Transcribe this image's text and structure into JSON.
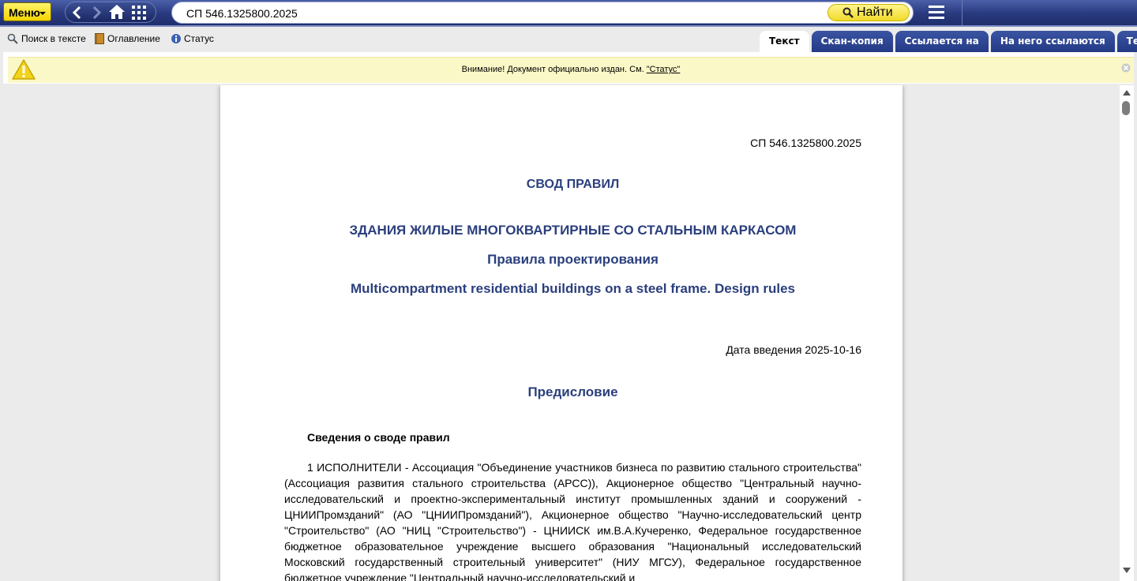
{
  "toolbar": {
    "menu_label": "Меню",
    "search_value": "СП 546.1325800.2025",
    "find_label": "Найти"
  },
  "tools": {
    "search_in_text": "Поиск в тексте",
    "contents": "Оглавление",
    "status": "Статус"
  },
  "tabs": [
    {
      "label": "Текст",
      "active": true
    },
    {
      "label": "Скан-копия",
      "active": false
    },
    {
      "label": "Ссылается на",
      "active": false
    },
    {
      "label": "На него ссылаются",
      "active": false
    },
    {
      "label": "Термины",
      "active": false
    }
  ],
  "warning": {
    "text": "Внимание! Документ официально издан. См. ",
    "link": "\"Статус\""
  },
  "document": {
    "code": "СП 546.1325800.2025",
    "type_title": "СВОД ПРАВИЛ",
    "title": "ЗДАНИЯ ЖИЛЫЕ МНОГОКВАРТИРНЫЕ СО СТАЛЬНЫМ КАРКАСОМ",
    "subtitle": "Правила проектирования",
    "title_en": "Multicompartment residential buildings on a steel frame. Design rules",
    "intro_date": "Дата введения 2025-10-16",
    "foreword_title": "Предисловие",
    "info_title": "Сведения о своде правил",
    "para1": "1 ИСПОЛНИТЕЛИ - Ассоциация \"Объединение участников бизнеса по развитию стального строительства\" (Ассоциация развития стального строительства (АРСС)), Акционерное общество \"Центральный научно-исследовательский и проектно-экспериментальный институт промышленных зданий и сооружений - ЦНИИПромзданий\" (АО \"ЦНИИПромзданий\"), Акционерное общество \"Научно-исследовательский центр \"Строительство\" (АО \"НИЦ \"Строительство\") - ЦНИИСК им.В.А.Кучеренко, Федеральное государственное бюджетное образовательное учреждение высшего образования \"Национальный исследовательский Московский государственный строительный университет\" (НИУ МГСУ), Федеральное государственное бюджетное учреждение \"Центральный научно-исследовательский и"
  },
  "colors": {
    "toolbar_blue": "#28397e",
    "accent_yellow": "#f2d400",
    "heading_blue": "#2b3f7d",
    "warning_bg": "#fbf8c7"
  }
}
